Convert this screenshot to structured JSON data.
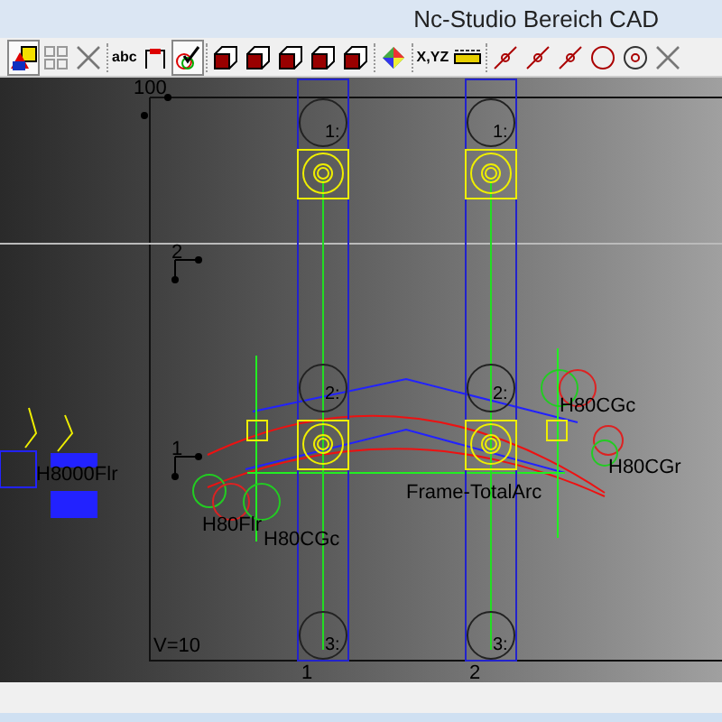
{
  "window": {
    "title": "Nc-Studio Bereich CAD"
  },
  "toolbar": [
    {
      "kind": "shapes",
      "selected": true
    },
    {
      "kind": "grid",
      "selected": false
    },
    {
      "kind": "cross",
      "selected": false
    },
    {
      "kind": "separator"
    },
    {
      "kind": "text",
      "label": "abc",
      "selected": false
    },
    {
      "kind": "flag",
      "selected": false
    },
    {
      "kind": "check",
      "selected": true
    },
    {
      "kind": "separator"
    },
    {
      "kind": "box",
      "selected": false
    },
    {
      "kind": "box",
      "selected": false
    },
    {
      "kind": "box",
      "selected": false
    },
    {
      "kind": "box",
      "selected": false
    },
    {
      "kind": "box",
      "selected": false
    },
    {
      "kind": "separator"
    },
    {
      "kind": "color",
      "selected": false
    },
    {
      "kind": "separator"
    },
    {
      "kind": "text",
      "label": "X,YZ",
      "selected": false
    },
    {
      "kind": "ruler",
      "selected": false
    },
    {
      "kind": "separator"
    },
    {
      "kind": "line",
      "selected": false
    },
    {
      "kind": "line",
      "selected": false
    },
    {
      "kind": "line",
      "selected": false
    },
    {
      "kind": "circle",
      "selected": false
    },
    {
      "kind": "target",
      "selected": false
    },
    {
      "kind": "cross",
      "selected": false
    }
  ],
  "canvas": {
    "top_label": "100",
    "rows": [
      "2",
      "1"
    ],
    "view_label": "V=10",
    "columns": [
      {
        "label": "1",
        "nodes": [
          "1:",
          "2:",
          "3:"
        ]
      },
      {
        "label": "2",
        "nodes": [
          "1:",
          "2:",
          "3:"
        ]
      }
    ],
    "annotations": [
      "H80CGc",
      "H80CGr",
      "Frame-TotalArc",
      "H80Flr",
      "H80CGc",
      "H8000Flr"
    ]
  }
}
